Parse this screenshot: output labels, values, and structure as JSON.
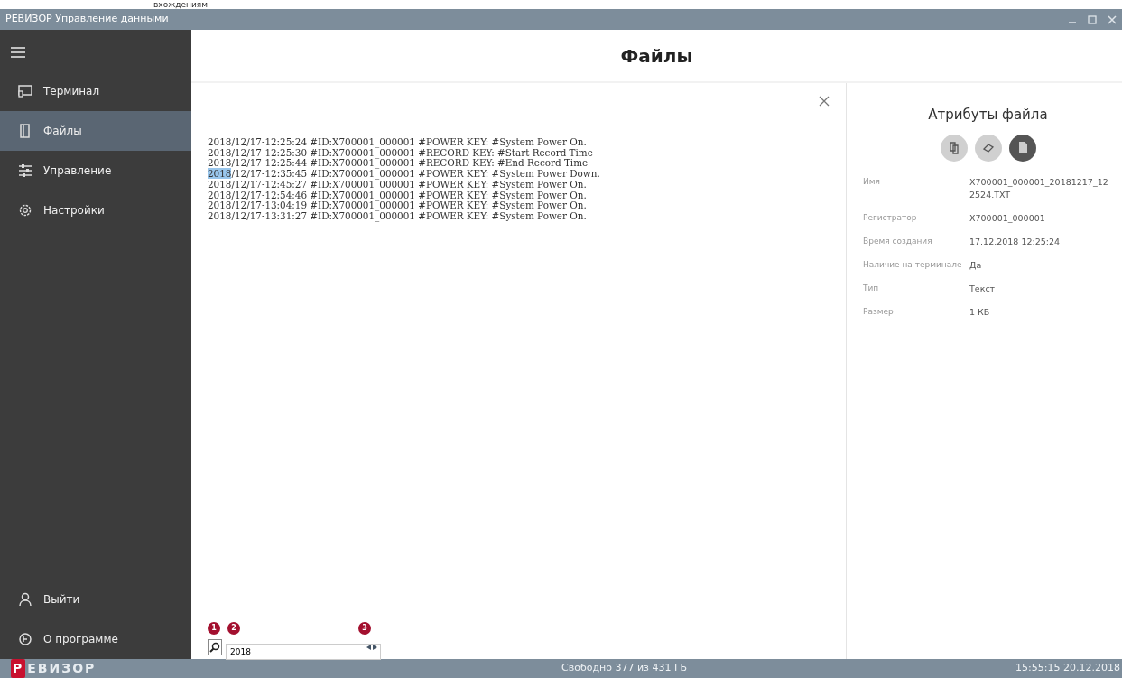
{
  "caption": "вхождениям",
  "window": {
    "title": "РЕВИЗОР Управление данными"
  },
  "sidebar": {
    "items": [
      {
        "kind": "terminal",
        "label": "Терминал",
        "selected": false
      },
      {
        "kind": "files",
        "label": "Файлы",
        "selected": true
      },
      {
        "kind": "control",
        "label": "Управление",
        "selected": false
      },
      {
        "kind": "settings",
        "label": "Настройки",
        "selected": false
      }
    ],
    "bottom_items": [
      {
        "kind": "logout",
        "label": "Выйти"
      },
      {
        "kind": "about",
        "label": "О программе"
      }
    ],
    "logo": {
      "first": "Р",
      "rest": "ЕВИЗОР"
    }
  },
  "page_title": "Файлы",
  "log_lines": [
    {
      "segments": [
        {
          "text": "2018/12/17-12:25:24 #ID:X700001_000001 #POWER KEY: #System Power On.",
          "highlighted": false
        }
      ]
    },
    {
      "segments": [
        {
          "text": "2018/12/17-12:25:30 #ID:X700001_000001 #RECORD KEY: #Start Record Time",
          "highlighted": false
        }
      ]
    },
    {
      "segments": [
        {
          "text": "2018/12/17-12:25:44 #ID:X700001_000001 #RECORD KEY: #End Record Time",
          "highlighted": false
        }
      ]
    },
    {
      "segments": [
        {
          "text": "2018",
          "highlighted": true
        },
        {
          "text": "/12/17-12:35:45 #ID:X700001_000001 #POWER KEY: #System Power Down.",
          "highlighted": false
        }
      ]
    },
    {
      "segments": [
        {
          "text": "2018/12/17-12:45:27 #ID:X700001_000001 #POWER KEY: #System Power On.",
          "highlighted": false
        }
      ]
    },
    {
      "segments": [
        {
          "text": "2018/12/17-12:54:46 #ID:X700001_000001 #POWER KEY: #System Power On.",
          "highlighted": false
        }
      ]
    },
    {
      "segments": [
        {
          "text": "2018/12/17-13:04:19 #ID:X700001_000001 #POWER KEY: #System Power On.",
          "highlighted": false
        }
      ]
    },
    {
      "segments": [
        {
          "text": "2018/12/17-13:31:27 #ID:X700001_000001 #POWER KEY: #System Power On.",
          "highlighted": false
        }
      ]
    }
  ],
  "search": {
    "value": "2018",
    "markers": [
      "1",
      "2",
      "3"
    ]
  },
  "attributes": {
    "title": "Атрибуты файла",
    "actions": [
      {
        "kind": "copy",
        "dark": false
      },
      {
        "kind": "erase",
        "dark": false
      },
      {
        "kind": "file",
        "dark": true
      }
    ],
    "rows": [
      {
        "label": "Имя",
        "value": "X700001_000001_20181217_122524.TXT"
      },
      {
        "label": "Регистратор",
        "value": "X700001_000001"
      },
      {
        "label": "Время создания",
        "value": "17.12.2018 12:25:24"
      },
      {
        "label": "Наличие на терминале",
        "value": "Да"
      },
      {
        "label": "Тип",
        "value": "Текст"
      },
      {
        "label": "Размер",
        "value": "1 КБ"
      }
    ]
  },
  "status_bar": {
    "free": "Свободно 377 из 431 ГБ",
    "datetime": "15:55:15 20.12.2018"
  }
}
